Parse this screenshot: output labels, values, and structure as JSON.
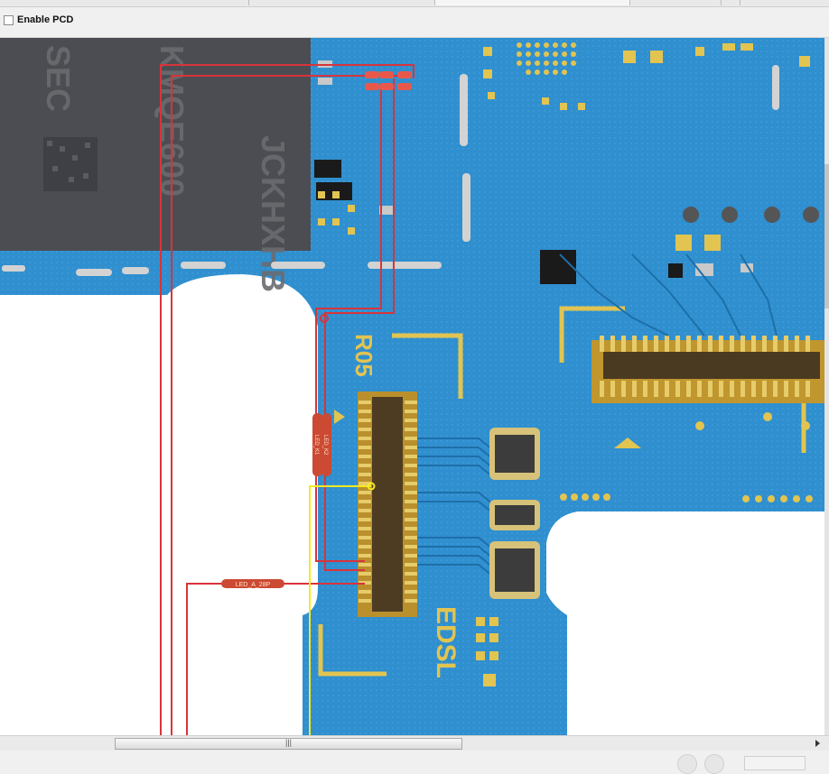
{
  "pcd": {
    "label": "Enable PCD",
    "checked": false
  },
  "board": {
    "chip_text_1": "SEC",
    "chip_text_2": "KMQE600",
    "chip_text_3": "JCKHXHB",
    "text_r05": "R05",
    "text_edsl": "EDSL",
    "net_led_a": "LED_A_28P",
    "net_led_k1": "LED_K1",
    "net_led_k2": "LED_K2"
  },
  "scrollbar": {
    "grip": "|||"
  },
  "colors": {
    "pcb_blue": "#2f8fcf",
    "pad_gold": "#d8b640",
    "trace_red": "#d8343a",
    "trace_yellow": "#f6ea1e",
    "label_orange": "#cc4a33"
  }
}
